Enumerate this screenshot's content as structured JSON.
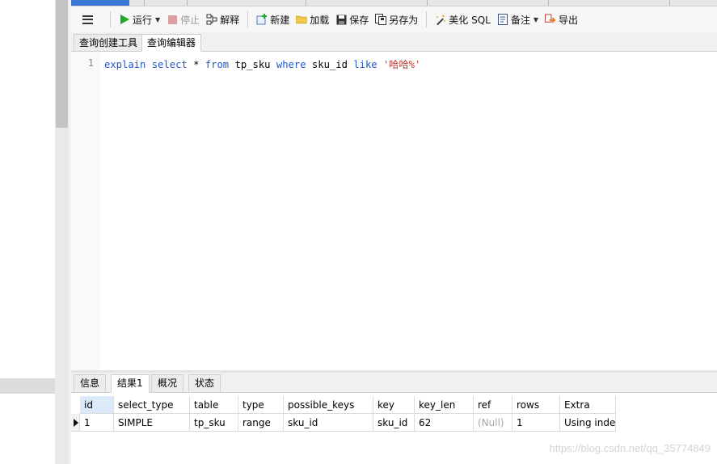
{
  "colors": {
    "accent": "#3a78d6",
    "keyword": "#2255cc",
    "string": "#c0392b"
  },
  "toolbar": {
    "run_label": "运行",
    "stop_label": "停止",
    "explain_label": "解释",
    "new_label": "新建",
    "load_label": "加载",
    "save_label": "保存",
    "save_as_label": "另存为",
    "beautify_label": "美化 SQL",
    "comment_label": "备注",
    "export_label": "导出"
  },
  "editor_tabs": [
    "查询创建工具",
    "查询编辑器"
  ],
  "editor": {
    "line_number": "1",
    "code": {
      "k1": "explain",
      "k2": "select",
      "t1": "*",
      "k3": "from",
      "t2": "tp_sku",
      "k4": "where",
      "t3": "sku_id",
      "k5": "like",
      "s1": "'哈哈%'"
    }
  },
  "result_tabs": [
    "信息",
    "结果1",
    "概况",
    "状态"
  ],
  "results": {
    "columns": [
      "id",
      "select_type",
      "table",
      "type",
      "possible_keys",
      "key",
      "key_len",
      "ref",
      "rows",
      "Extra"
    ],
    "rows": [
      [
        "1",
        "SIMPLE",
        "tp_sku",
        "range",
        "sku_id",
        "sku_id",
        "62",
        "(Null)",
        "1",
        "Using index"
      ]
    ]
  },
  "watermark": "https://blog.csdn.net/qq_35774849"
}
